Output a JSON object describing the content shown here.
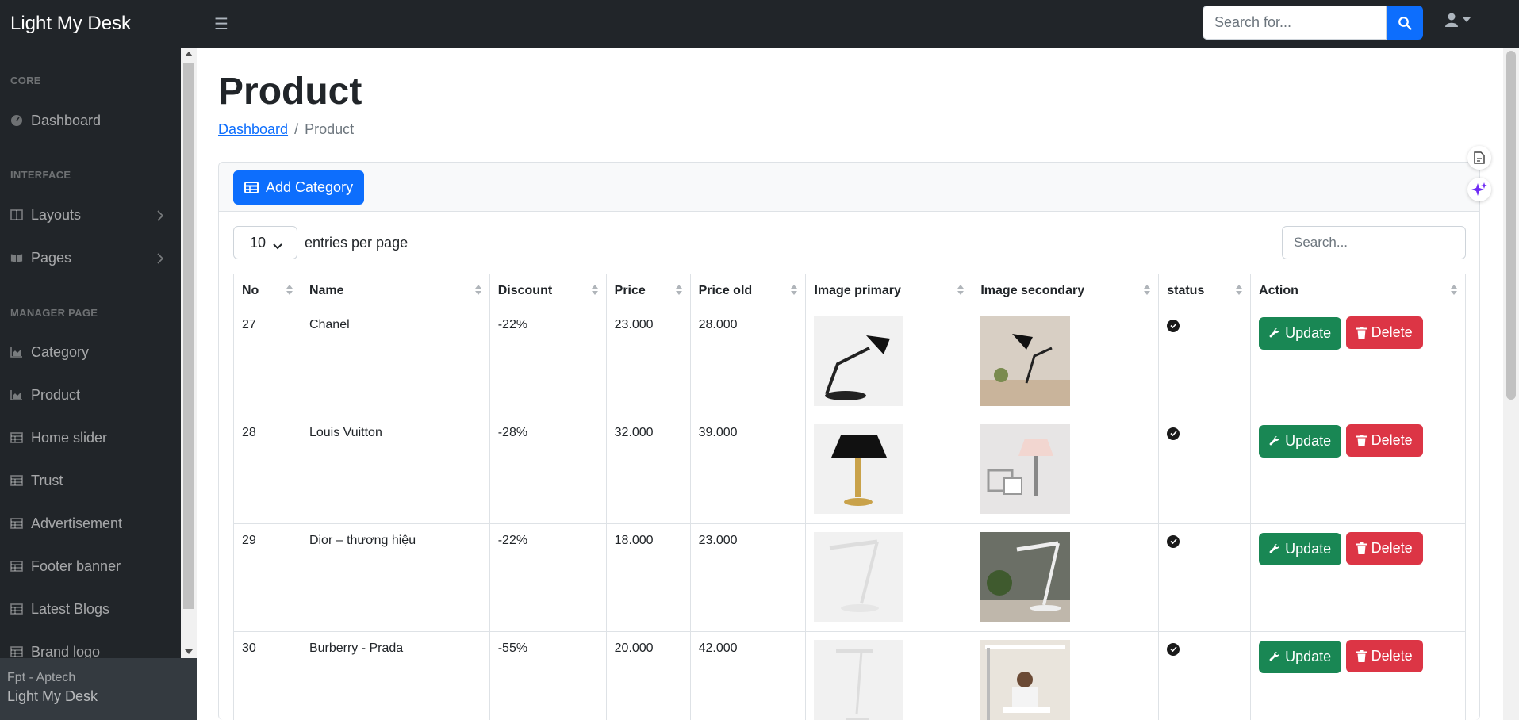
{
  "app": {
    "brand": "Light My Desk"
  },
  "topnav": {
    "search_placeholder": "Search for..."
  },
  "sidebar": {
    "sections": [
      {
        "heading": "CORE"
      },
      {
        "heading": "INTERFACE"
      },
      {
        "heading": "MANAGER PAGE"
      }
    ],
    "items": [
      {
        "label": "Dashboard",
        "icon": "gauge-icon"
      },
      {
        "label": "Layouts",
        "icon": "columns-icon"
      },
      {
        "label": "Pages",
        "icon": "book-open-icon"
      },
      {
        "label": "Category",
        "icon": "chart-area-icon"
      },
      {
        "label": "Product",
        "icon": "chart-area-icon"
      },
      {
        "label": "Home slider",
        "icon": "table-icon"
      },
      {
        "label": "Trust",
        "icon": "table-icon"
      },
      {
        "label": "Advertisement",
        "icon": "table-icon"
      },
      {
        "label": "Footer banner",
        "icon": "table-icon"
      },
      {
        "label": "Latest Blogs",
        "icon": "table-icon"
      },
      {
        "label": "Brand logo",
        "icon": "table-icon"
      }
    ],
    "footer": {
      "small": "Fpt - Aptech",
      "big": "Light My Desk"
    }
  },
  "main": {
    "title": "Product",
    "breadcrumb": {
      "link": "Dashboard",
      "current": "Product"
    },
    "add_button": "Add Category",
    "per_page_value": "10",
    "per_page_label": "entries per page",
    "search_placeholder": "Search...",
    "columns": [
      "No",
      "Name",
      "Discount",
      "Price",
      "Price old",
      "Image primary",
      "Image secondary",
      "status",
      "Action"
    ],
    "rows": [
      {
        "no": "27",
        "name": "Chanel",
        "discount": "-22%",
        "price": "23.000",
        "price_old": "28.000"
      },
      {
        "no": "28",
        "name": "Louis Vuitton",
        "discount": "-28%",
        "price": "32.000",
        "price_old": "39.000"
      },
      {
        "no": "29",
        "name": "Dior – thương hiệu",
        "discount": "-22%",
        "price": "18.000",
        "price_old": "23.000"
      },
      {
        "no": "30",
        "name": "Burberry - Prada",
        "discount": "-55%",
        "price": "20.000",
        "price_old": "42.000"
      }
    ],
    "update_label": "Update",
    "delete_label": "Delete"
  },
  "colors": {
    "primary": "#0d6efd",
    "success": "#198754",
    "danger": "#dc3545",
    "dark": "#212529"
  }
}
